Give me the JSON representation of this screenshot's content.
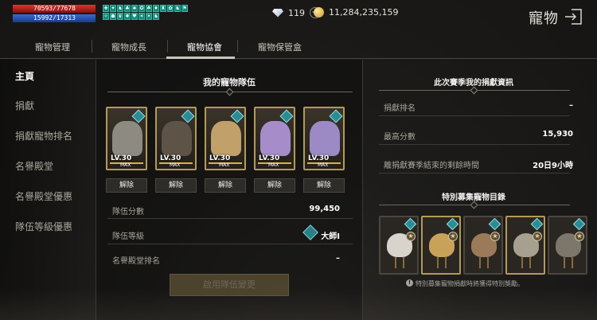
{
  "status": {
    "hp": "70593/77678",
    "mp": "15992/17313",
    "buff_count": 20
  },
  "currency": {
    "gems": "119",
    "gold": "11,284,235,159"
  },
  "header": {
    "title": "寵物"
  },
  "tabs": [
    {
      "label": "寵物管理"
    },
    {
      "label": "寵物成長"
    },
    {
      "label": "寵物協會"
    },
    {
      "label": "寵物保管盒"
    }
  ],
  "active_tab": "寵物協會",
  "sidebar": {
    "items": [
      {
        "label": "主頁"
      },
      {
        "label": "捐獻"
      },
      {
        "label": "捐獻寵物排名"
      },
      {
        "label": "名譽殿堂"
      },
      {
        "label": "名譽殿堂優惠"
      },
      {
        "label": "隊伍等級優惠"
      }
    ]
  },
  "team": {
    "title": "我的寵物隊伍",
    "pets": [
      {
        "level": "LV.30",
        "max": "MAX",
        "release": "解除",
        "color": "#8d8a82"
      },
      {
        "level": "LV.30",
        "max": "MAX",
        "release": "解除",
        "color": "#5d5346"
      },
      {
        "level": "LV.30",
        "max": "MAX",
        "release": "解除",
        "color": "#c2a06a"
      },
      {
        "level": "LV.30",
        "max": "MAX",
        "release": "解除",
        "color": "#a68dc9"
      },
      {
        "level": "LV.30",
        "max": "MAX",
        "release": "解除",
        "color": "#9c8ac4"
      }
    ],
    "score_label": "隊伍分數",
    "score_value": "99,450",
    "level_label": "隊伍等級",
    "level_value": "大師I",
    "rank_label": "名譽殿堂排名",
    "rank_value": "–",
    "apply_button": "啟用隊伍變更"
  },
  "season": {
    "title": "此次賽季我的捐獻資訊",
    "rows": [
      {
        "label": "捐獻排名",
        "value": "–"
      },
      {
        "label": "最高分數",
        "value": "15,930"
      },
      {
        "label": "離捐獻賽季結束的剩餘時間",
        "value": "20日9小時"
      }
    ],
    "special_title": "特別募集寵物目錄",
    "special_pets": [
      {
        "color": "#d8d4cc"
      },
      {
        "color": "#c9a25a"
      },
      {
        "color": "#9b7a5a"
      },
      {
        "color": "#a7a090"
      },
      {
        "color": "#7d766a"
      }
    ],
    "note": "特別募集寵物捐獻時將獲得特別獎勵。"
  },
  "colors": {
    "accent_gold": "#b59a55",
    "badge_teal": "#2b8c93",
    "hp_red": "#cc2a2a",
    "mp_blue": "#2a5ac0"
  },
  "icons": {
    "gem": "diamond-icon",
    "gold": "coin-icon",
    "exit": "exit-icon",
    "rank": "diamond-rank-icon"
  }
}
